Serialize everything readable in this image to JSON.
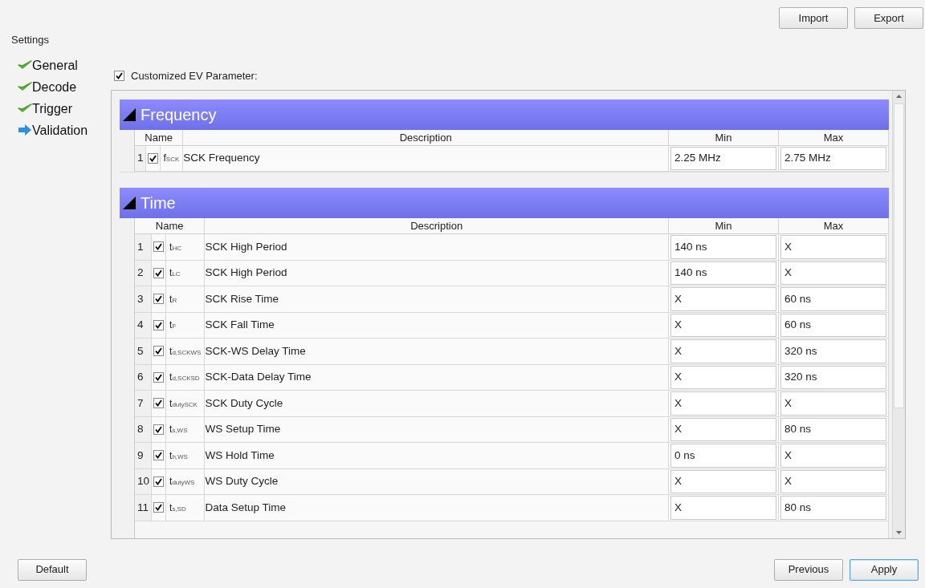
{
  "top_buttons": [
    "Import",
    "Export"
  ],
  "sidebar": {
    "title": "Settings",
    "items": [
      {
        "label": "General",
        "kind": "done"
      },
      {
        "label": "Decode",
        "kind": "done"
      },
      {
        "label": "Trigger",
        "kind": "done"
      },
      {
        "label": "Validation",
        "kind": "current"
      }
    ]
  },
  "customized": {
    "label": "Customized EV Parameter:",
    "checked": true
  },
  "sections": [
    {
      "title": "Frequency",
      "expanded": true,
      "columns": [
        "Name",
        "Description",
        "Min",
        "Max"
      ],
      "rows": [
        {
          "index": "1",
          "checked": true,
          "symbol": "f$_{SCK}$",
          "description": "SCK Frequency",
          "min": "2.25 MHz",
          "max": "2.75 MHz"
        }
      ]
    },
    {
      "title": "Time",
      "expanded": true,
      "columns": [
        "Name",
        "Description",
        "Min",
        "Max"
      ],
      "rows": [
        {
          "index": "1",
          "checked": true,
          "symbol": "t$_{HC}$",
          "description": "SCK High Period",
          "min": "140 ns",
          "max": "X"
        },
        {
          "index": "2",
          "checked": true,
          "symbol": "t$_{LC}$",
          "description": "SCK High Period",
          "min": "140 ns",
          "max": "X"
        },
        {
          "index": "3",
          "checked": true,
          "symbol": "t$_{R}$",
          "description": "SCK Rise Time",
          "min": "X",
          "max": "60 ns"
        },
        {
          "index": "4",
          "checked": true,
          "symbol": "t$_{F}$",
          "description": "SCK Fall Time",
          "min": "X",
          "max": "60 ns"
        },
        {
          "index": "5",
          "checked": true,
          "symbol": "t$_{d,SCKWS}$",
          "description": "SCK-WS Delay Time",
          "min": "X",
          "max": "320 ns"
        },
        {
          "index": "6",
          "checked": true,
          "symbol": "t$_{d,SCKSD}$",
          "description": "SCK-Data Delay Time",
          "min": "X",
          "max": "320 ns"
        },
        {
          "index": "7",
          "checked": true,
          "symbol": "t$_{dutySCK}$",
          "description": "SCK Duty Cycle",
          "min": "X",
          "max": "X"
        },
        {
          "index": "8",
          "checked": true,
          "symbol": "t$_{s,WS}$",
          "description": "WS Setup Time",
          "min": "X",
          "max": "80 ns"
        },
        {
          "index": "9",
          "checked": true,
          "symbol": "t$_{h,WS}$",
          "description": "WS Hold Time",
          "min": "0 ns",
          "max": "X"
        },
        {
          "index": "10",
          "checked": true,
          "symbol": "t$_{dutyWS}$",
          "description": "WS Duty Cycle",
          "min": "X",
          "max": "X"
        },
        {
          "index": "11",
          "checked": true,
          "symbol": "t$_{s,SD}$",
          "description": "Data Setup Time",
          "min": "X",
          "max": "80 ns"
        }
      ]
    }
  ],
  "bottom_left_buttons": [
    "Default"
  ],
  "bottom_right_buttons": [
    {
      "label": "Previous",
      "kind": "normal"
    },
    {
      "label": "Apply",
      "kind": "default"
    }
  ]
}
